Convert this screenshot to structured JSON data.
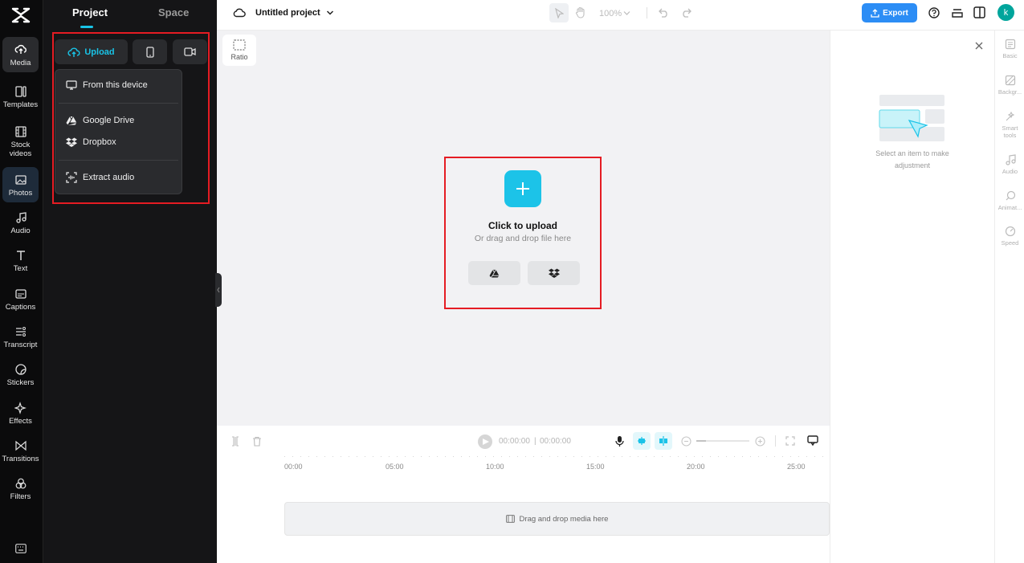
{
  "app": {
    "project_name": "Untitled project"
  },
  "rail": {
    "items": [
      {
        "label": "Media",
        "icon": "media-icon"
      },
      {
        "label": "Templates",
        "icon": "templates-icon"
      },
      {
        "label": "Stock\nvideos",
        "icon": "film-icon"
      },
      {
        "label": "Photos",
        "icon": "image-icon"
      },
      {
        "label": "Audio",
        "icon": "music-icon"
      },
      {
        "label": "Text",
        "icon": "text-icon"
      },
      {
        "label": "Captions",
        "icon": "captions-icon"
      },
      {
        "label": "Transcript",
        "icon": "transcript-icon"
      },
      {
        "label": "Stickers",
        "icon": "sticker-icon"
      },
      {
        "label": "Effects",
        "icon": "sparkle-icon"
      },
      {
        "label": "Transitions",
        "icon": "transition-icon"
      },
      {
        "label": "Filters",
        "icon": "filter-icon"
      }
    ]
  },
  "panel": {
    "tabs": [
      "Project",
      "Space"
    ],
    "upload_label": "Upload",
    "menu": [
      {
        "label": "From this device",
        "icon": "monitor-icon"
      },
      {
        "label": "Google Drive",
        "icon": "google-drive-icon"
      },
      {
        "label": "Dropbox",
        "icon": "dropbox-icon"
      },
      {
        "label": "Extract audio",
        "icon": "audio-extract-icon"
      }
    ]
  },
  "topbar": {
    "zoom": "100%",
    "export_label": "Export",
    "avatar_letter": "k"
  },
  "canvas": {
    "ratio_label": "Ratio",
    "upload_title": "Click to upload",
    "upload_sub": "Or drag and drop file here"
  },
  "right_panel": {
    "hint": "Select an item to make adjustment",
    "rail": [
      "Basic",
      "Backgr...",
      "Smart tools",
      "Audio",
      "Animat...",
      "Speed"
    ]
  },
  "timeline": {
    "current_time": "00:00:00",
    "total_time": "00:00:00",
    "ruler": [
      "00:00",
      "05:00",
      "10:00",
      "15:00",
      "20:00",
      "25:00"
    ],
    "drop_hint": "Drag and drop media here"
  },
  "colors": {
    "accent": "#1cc3e8",
    "export": "#2c8df5",
    "highlight": "#e51c23"
  }
}
